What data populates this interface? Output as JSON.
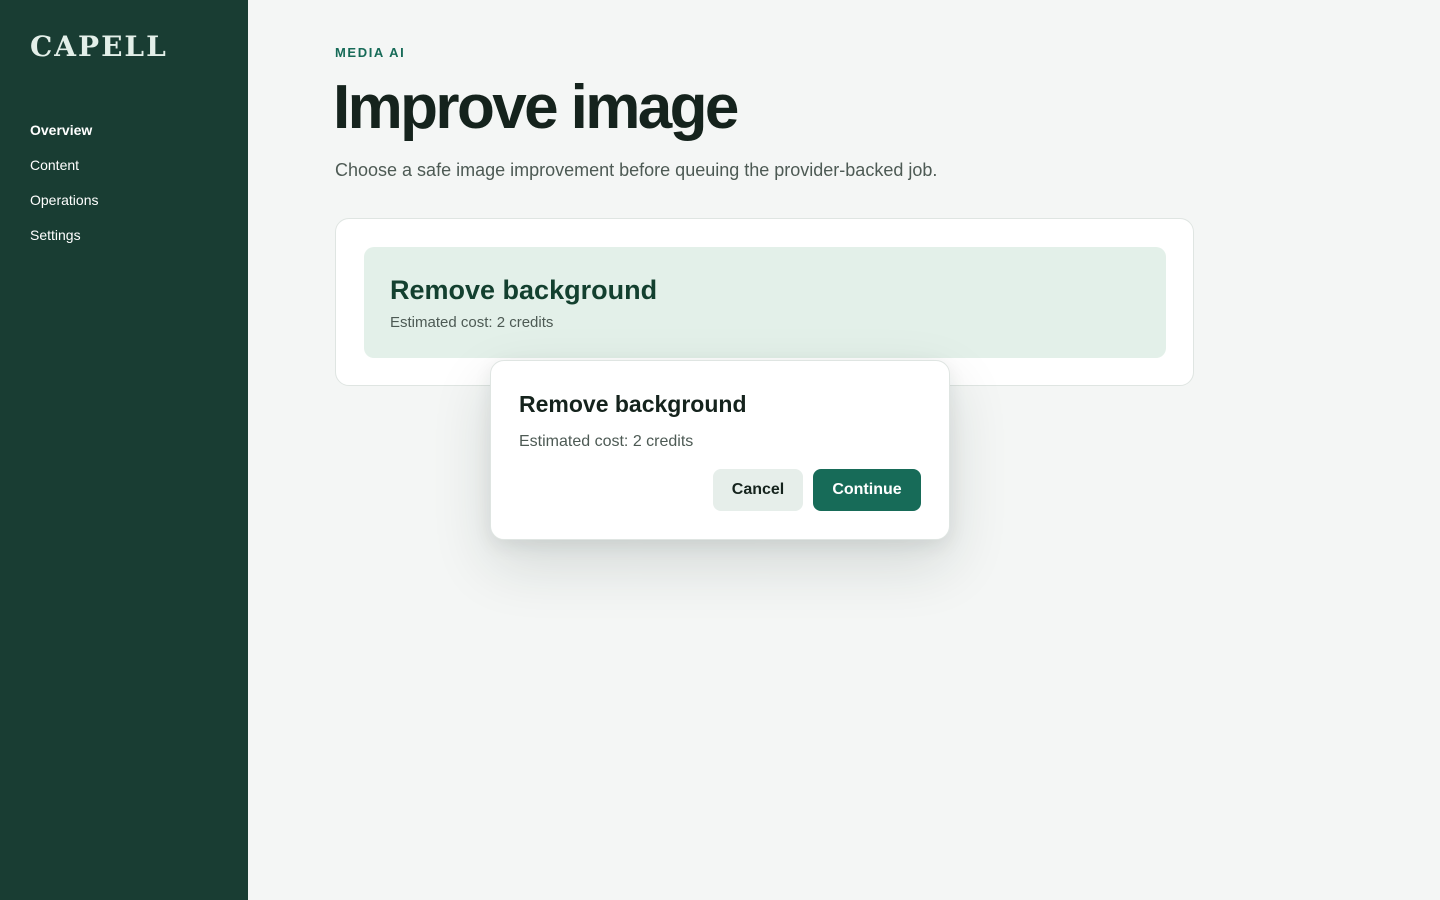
{
  "sidebar": {
    "logo": "CAPELL",
    "items": [
      {
        "label": "Overview",
        "active": true
      },
      {
        "label": "Content"
      },
      {
        "label": "Operations"
      },
      {
        "label": "Settings"
      }
    ]
  },
  "header": {
    "eyebrow": "MEDIA AI",
    "title": "Improve image",
    "subtitle": "Choose a safe image improvement before queuing the provider-backed job."
  },
  "option": {
    "title": "Remove background",
    "cost": "Estimated cost: 2 credits"
  },
  "dialog": {
    "title": "Remove background",
    "cost": "Estimated cost: 2 credits",
    "cancel_label": "Cancel",
    "continue_label": "Continue"
  },
  "colors": {
    "sidebar_bg": "#193d33",
    "accent": "#176b58",
    "option_bg": "#e3f0e9",
    "page_bg": "#f4f6f5"
  }
}
